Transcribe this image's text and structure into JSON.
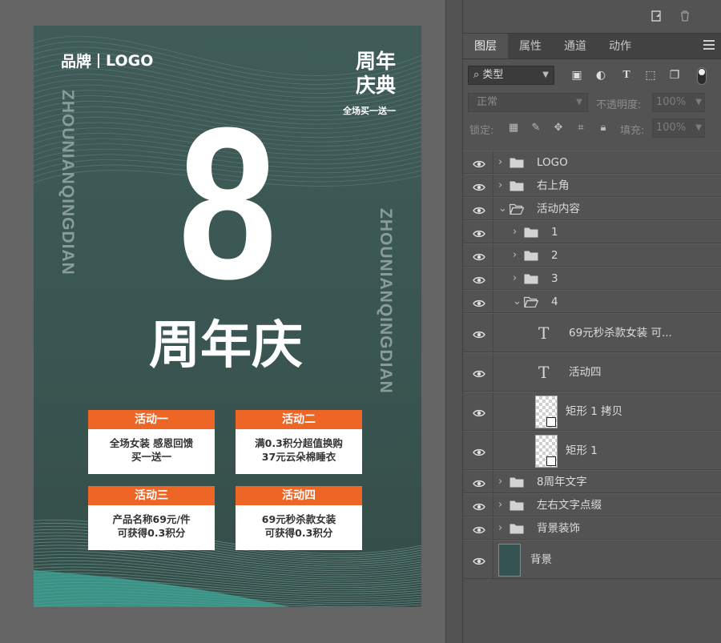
{
  "poster": {
    "brand_left": "品牌",
    "brand_right": "LOGO",
    "corner_title_line1": "周年",
    "corner_title_line2": "庆典",
    "corner_sub": "全场买一送一",
    "side_text": "ZHOUNIANQINGDIAN",
    "big_number": "8",
    "anniv_title": "周年庆",
    "activities": [
      {
        "title": "活动一",
        "line1": "全场女装 感恩回馈",
        "line2": "买一送一"
      },
      {
        "title": "活动二",
        "line1": "满0.3积分超值换购",
        "line2": "37元云朵棉睡衣"
      },
      {
        "title": "活动三",
        "line1": "产品名称69元/件",
        "line2": "可获得0.3积分"
      },
      {
        "title": "活动四",
        "line1": "69元秒杀款女装",
        "line2": "可获得0.3积分"
      }
    ],
    "colors": {
      "background": "#3a5551",
      "accent": "#ee6626",
      "card": "#ffffff"
    }
  },
  "panel": {
    "top_icons": [
      "new-layer-icon",
      "trash-icon"
    ],
    "tabs": [
      "图层",
      "属性",
      "通道",
      "动作"
    ],
    "filter": {
      "label": "类型",
      "icons": [
        "image-filter-icon",
        "adjustment-filter-icon",
        "type-filter-icon",
        "shape-filter-icon",
        "smart-object-filter-icon"
      ]
    },
    "blend_mode": "正常",
    "opacity_label": "不透明度:",
    "opacity_value": "100%",
    "lock_label": "锁定:",
    "fill_label": "填充:",
    "fill_value": "100%",
    "layers": [
      {
        "name": "LOGO",
        "type": "group",
        "expanded": false,
        "level": 0
      },
      {
        "name": "右上角",
        "type": "group",
        "expanded": false,
        "level": 0
      },
      {
        "name": "活动内容",
        "type": "group",
        "expanded": true,
        "level": 0
      },
      {
        "name": "1",
        "type": "group",
        "expanded": false,
        "level": 1
      },
      {
        "name": "2",
        "type": "group",
        "expanded": false,
        "level": 1
      },
      {
        "name": "3",
        "type": "group",
        "expanded": false,
        "level": 1
      },
      {
        "name": "4",
        "type": "group",
        "expanded": true,
        "level": 1
      },
      {
        "name": "69元秒杀款女装 可...",
        "type": "text",
        "level": 2
      },
      {
        "name": "活动四",
        "type": "text",
        "level": 2
      },
      {
        "name": "矩形 1 拷贝",
        "type": "shape",
        "level": 2
      },
      {
        "name": "矩形 1",
        "type": "shape",
        "level": 2
      },
      {
        "name": "8周年文字",
        "type": "group",
        "expanded": false,
        "level": 0
      },
      {
        "name": "左右文字点缀",
        "type": "group",
        "expanded": false,
        "level": 0
      },
      {
        "name": "背景装饰",
        "type": "group",
        "expanded": false,
        "level": 0
      },
      {
        "name": "背景",
        "type": "image",
        "level": 0
      }
    ]
  }
}
